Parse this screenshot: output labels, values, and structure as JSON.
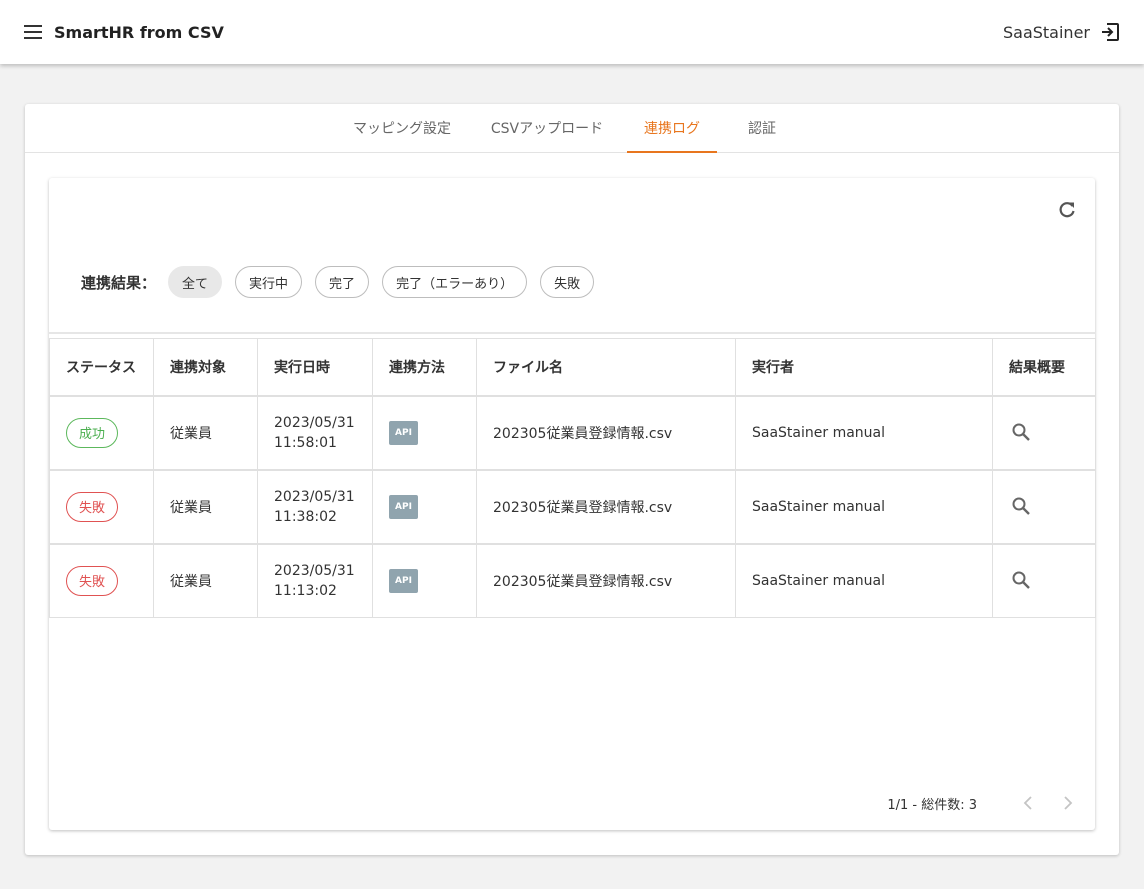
{
  "app": {
    "title": "SmartHR from CSV",
    "user": "SaaStainer"
  },
  "tabs": [
    {
      "label": "マッピング設定",
      "active": false
    },
    {
      "label": "CSVアップロード",
      "active": false
    },
    {
      "label": "連携ログ",
      "active": true
    },
    {
      "label": "認証",
      "active": false
    }
  ],
  "filter": {
    "label": "連携結果：",
    "chips": [
      {
        "label": "全て",
        "selected": true
      },
      {
        "label": "実行中",
        "selected": false
      },
      {
        "label": "完了",
        "selected": false
      },
      {
        "label": "完了（エラーあり）",
        "selected": false
      },
      {
        "label": "失敗",
        "selected": false
      }
    ]
  },
  "table": {
    "headers": [
      "ステータス",
      "連携対象",
      "実行日時",
      "連携方法",
      "ファイル名",
      "実行者",
      "結果概要"
    ],
    "rows": [
      {
        "status": "成功",
        "status_type": "success",
        "target": "従業員",
        "date": "2023/05/31",
        "time": "11:58:01",
        "method": "API",
        "file": "202305従業員登録情報.csv",
        "executor": "SaaStainer manual",
        "summary_icon": "search-icon"
      },
      {
        "status": "失敗",
        "status_type": "fail",
        "target": "従業員",
        "date": "2023/05/31",
        "time": "11:38:02",
        "method": "API",
        "file": "202305従業員登録情報.csv",
        "executor": "SaaStainer manual",
        "summary_icon": "search-icon"
      },
      {
        "status": "失敗",
        "status_type": "fail",
        "target": "従業員",
        "date": "2023/05/31",
        "time": "11:13:02",
        "method": "API",
        "file": "202305従業員登録情報.csv",
        "executor": "SaaStainer manual",
        "summary_icon": "search-icon"
      }
    ]
  },
  "pagination": {
    "info": "1/1 - 総件数: 3"
  },
  "colors": {
    "accent": "#e8761e",
    "success": "#4caf50",
    "fail": "#e05252",
    "api_badge": "#90a4ae"
  }
}
